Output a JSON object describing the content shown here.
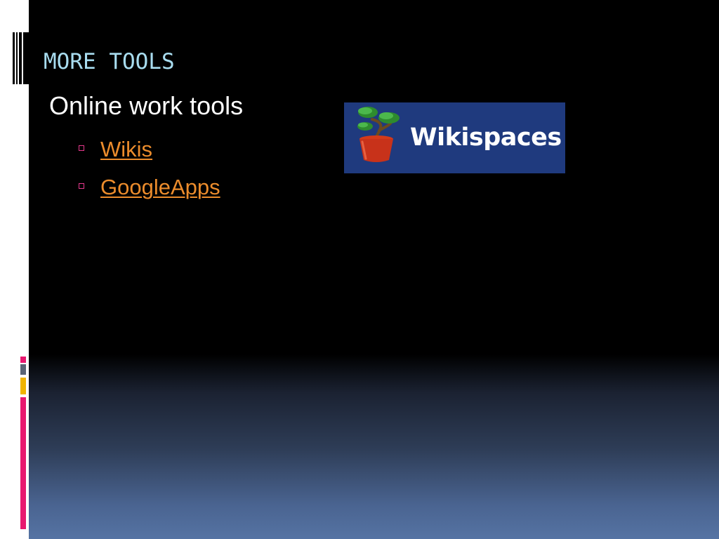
{
  "slide": {
    "title": "MORE TOOLS",
    "heading": "Online work tools",
    "links": [
      {
        "label": "Wikis"
      },
      {
        "label": "GoogleApps"
      }
    ],
    "logo": {
      "text": "Wikispaces",
      "icon": "bonsai-pot-icon"
    }
  },
  "colors": {
    "title": "#a8dcef",
    "heading": "#ffffff",
    "link": "#ec8c2c",
    "bullet": "#e4388c",
    "logo_bg": "#1f3a7e",
    "accent_pink": "#e8186f",
    "accent_gray": "#5a6475",
    "accent_gold": "#f0b400"
  }
}
